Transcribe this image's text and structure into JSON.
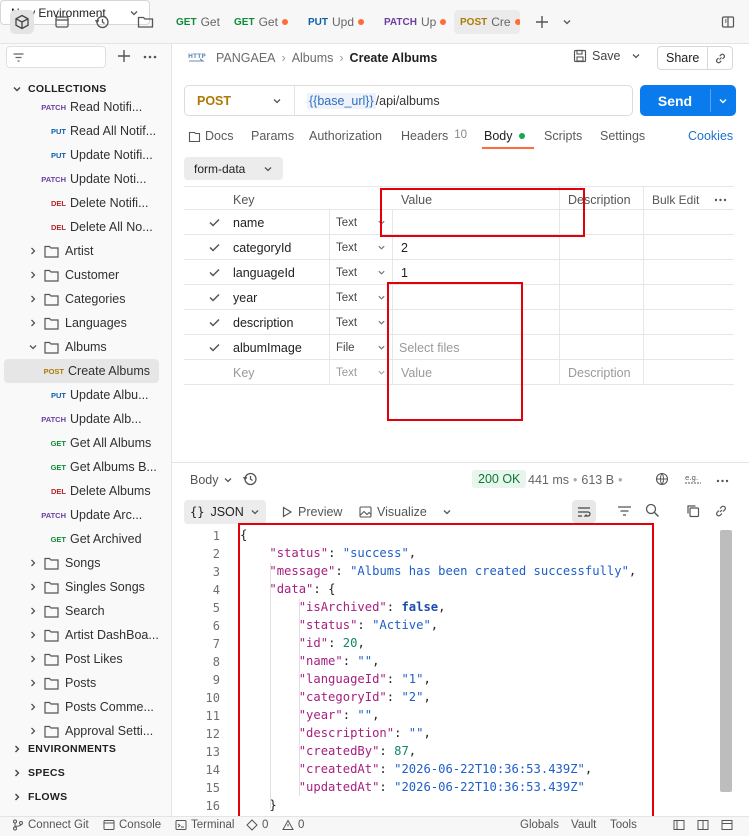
{
  "tabs": [
    {
      "method": "GET",
      "label": "Get",
      "suffix": ":"
    },
    {
      "method": "GET",
      "label": "Get"
    },
    {
      "method": "PUT",
      "label": "Upd"
    },
    {
      "method": "PATCH",
      "label": "Up"
    },
    {
      "method": "POST",
      "label": "Cre"
    }
  ],
  "environment": "New Environment",
  "sidebar": {
    "section_collections": "COLLECTIONS",
    "items": [
      {
        "method": "PATCH",
        "label": "Read Notifi...",
        "type": "request"
      },
      {
        "method": "PUT",
        "label": "Read All Notif...",
        "type": "request"
      },
      {
        "method": "PUT",
        "label": "Update Notifi...",
        "type": "request"
      },
      {
        "method": "PATCH",
        "label": "Update Noti...",
        "type": "request"
      },
      {
        "method": "DEL",
        "label": "Delete Notifi...",
        "type": "request"
      },
      {
        "method": "DEL",
        "label": "Delete All No...",
        "type": "request"
      },
      {
        "label": "Artist",
        "type": "folder"
      },
      {
        "label": "Customer",
        "type": "folder"
      },
      {
        "label": "Categories",
        "type": "folder"
      },
      {
        "label": "Languages",
        "type": "folder"
      },
      {
        "label": "Albums",
        "type": "folder-open"
      },
      {
        "method": "POST",
        "label": "Create Albums",
        "type": "request",
        "selected": true
      },
      {
        "method": "PUT",
        "label": "Update Albu...",
        "type": "request"
      },
      {
        "method": "PATCH",
        "label": "Update Alb...",
        "type": "request"
      },
      {
        "method": "GET",
        "label": "Get All Albums",
        "type": "request"
      },
      {
        "method": "GET",
        "label": "Get Albums B...",
        "type": "request"
      },
      {
        "method": "DEL",
        "label": "Delete Albums",
        "type": "request"
      },
      {
        "method": "PATCH",
        "label": "Update Arc...",
        "type": "request"
      },
      {
        "method": "GET",
        "label": "Get Archived",
        "type": "request"
      },
      {
        "label": "Songs",
        "type": "folder"
      },
      {
        "label": "Singles Songs",
        "type": "folder"
      },
      {
        "label": "Search",
        "type": "folder"
      },
      {
        "label": "Artist DashBoa...",
        "type": "folder"
      },
      {
        "label": "Post Likes",
        "type": "folder"
      },
      {
        "label": "Posts",
        "type": "folder"
      },
      {
        "label": "Posts Comme...",
        "type": "folder"
      },
      {
        "label": "Approval Setti...",
        "type": "folder"
      }
    ],
    "sections": [
      "ENVIRONMENTS",
      "SPECS",
      "FLOWS"
    ]
  },
  "breadcrumb": {
    "workspace": "PANGAEA",
    "folder": "Albums",
    "request": "Create Albums"
  },
  "actions": {
    "save": "Save",
    "share": "Share"
  },
  "request": {
    "method": "POST",
    "url_var": "{{base_url}}",
    "url_path": " /api/albums",
    "send": "Send"
  },
  "req_tabs": {
    "docs": "Docs",
    "params": "Params",
    "authorization": "Authorization",
    "headers": "Headers",
    "headers_count": "10",
    "body": "Body",
    "scripts": "Scripts",
    "settings": "Settings",
    "cookies": "Cookies"
  },
  "body_mode": "form-data",
  "table": {
    "headers": {
      "key": "Key",
      "value": "Value",
      "description": "Description",
      "bulk_edit": "Bulk Edit"
    },
    "rows": [
      {
        "key": "name",
        "type": "Text",
        "value": ""
      },
      {
        "key": "categoryId",
        "type": "Text",
        "value": "2"
      },
      {
        "key": "languageId",
        "type": "Text",
        "value": "1"
      },
      {
        "key": "year",
        "type": "Text",
        "value": ""
      },
      {
        "key": "description",
        "type": "Text",
        "value": ""
      },
      {
        "key": "albumImage",
        "type": "File",
        "value": "",
        "value_placeholder": "Select files"
      }
    ],
    "placeholder_row": {
      "key": "Key",
      "type": "Text",
      "value": "Value",
      "description": "Description"
    }
  },
  "response": {
    "body_label": "Body",
    "status": "200 OK",
    "time": "441 ms",
    "size": "613 B",
    "format": "JSON",
    "preview": "Preview",
    "visualize": "Visualize",
    "lines": [
      "{",
      "    \"status\": \"success\",",
      "    \"message\": \"Albums has been created successfully\",",
      "    \"data\": {",
      "        \"isArchived\": false,",
      "        \"status\": \"Active\",",
      "        \"id\": 20,",
      "        \"name\": \"\",",
      "        \"languageId\": \"1\",",
      "        \"categoryId\": \"2\",",
      "        \"year\": \"\",",
      "        \"description\": \"\",",
      "        \"createdBy\": 87,",
      "        \"createdAt\": \"2026-06-22T10:36:53.439Z\",",
      "        \"updatedAt\": \"2026-06-22T10:36:53.439Z\"",
      "    }"
    ]
  },
  "statusbar": {
    "connect_git": "Connect Git",
    "console": "Console",
    "terminal": "Terminal",
    "errors": "0",
    "warnings": "0",
    "globals": "Globals",
    "vault": "Vault",
    "tools": "Tools"
  }
}
